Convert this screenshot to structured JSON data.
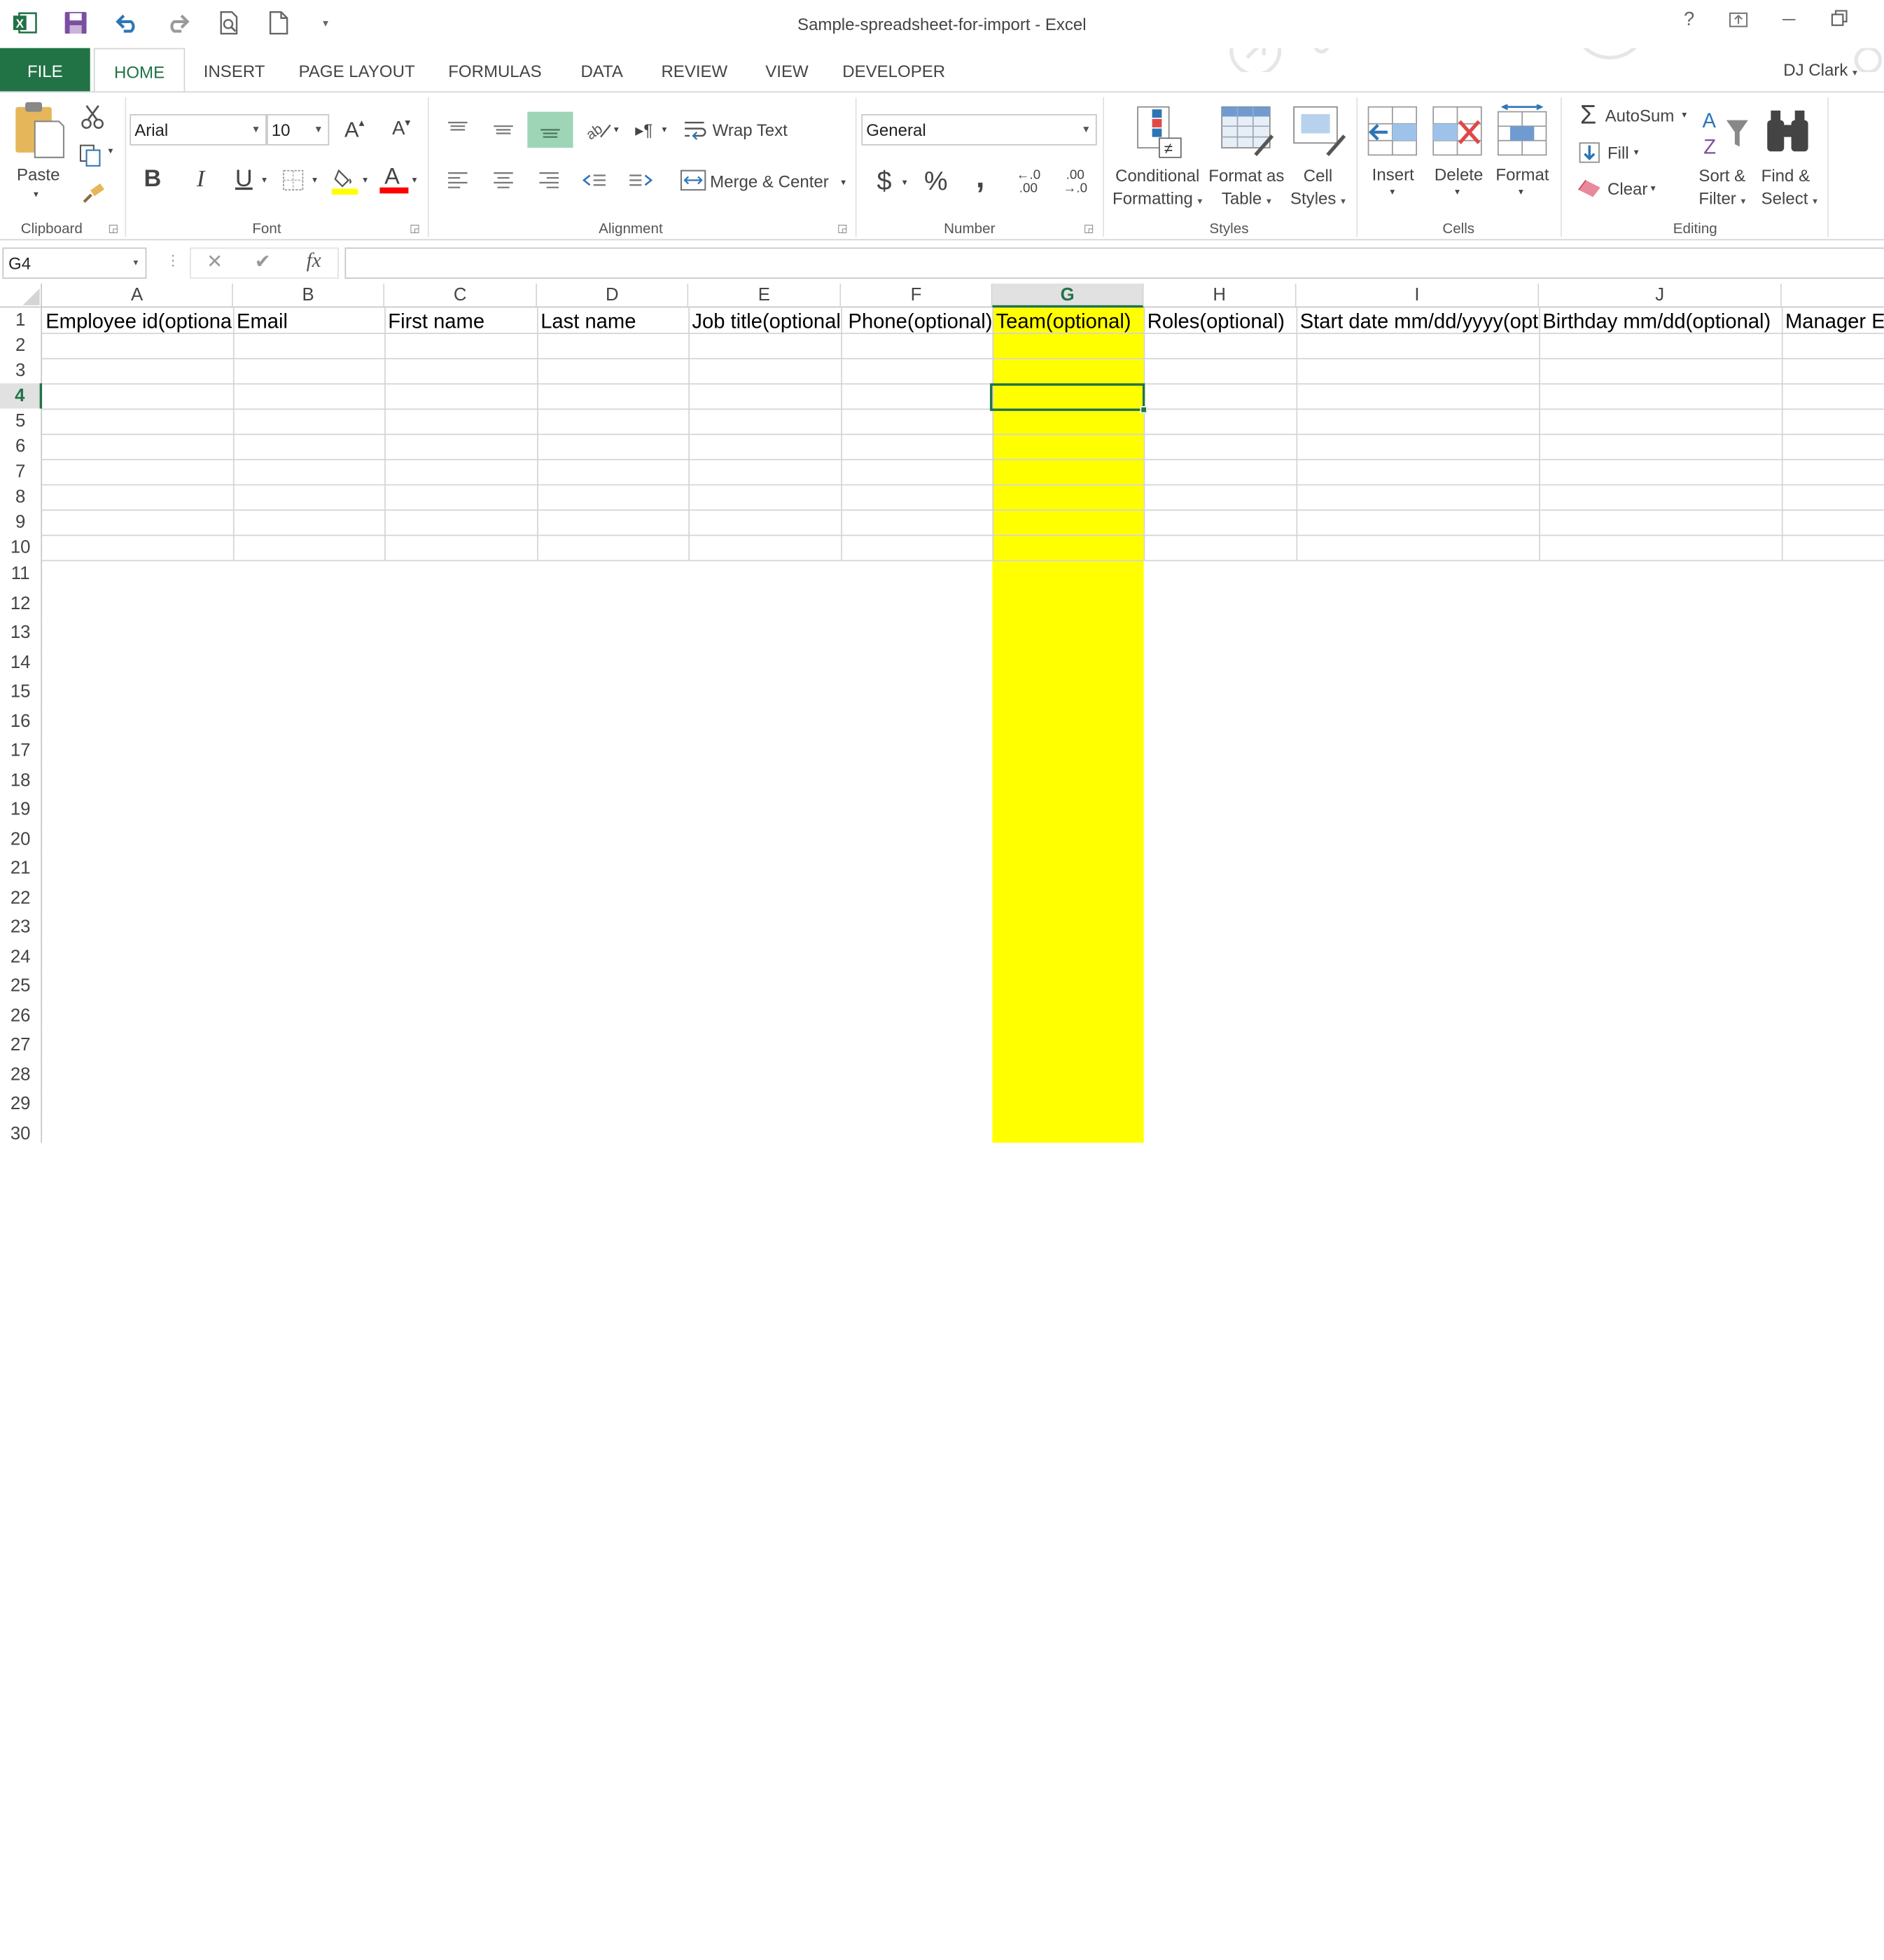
{
  "window": {
    "title": "Sample-spreadsheet-for-import - Excel",
    "user": "DJ Clark",
    "help": "?"
  },
  "tabs": [
    "FILE",
    "HOME",
    "INSERT",
    "PAGE LAYOUT",
    "FORMULAS",
    "DATA",
    "REVIEW",
    "VIEW",
    "DEVELOPER"
  ],
  "ribbon": {
    "clipboard": {
      "label": "Clipboard",
      "paste": "Paste"
    },
    "font": {
      "label": "Font",
      "name": "Arial",
      "size": "10",
      "bold": "B",
      "italic": "I",
      "underline": "U"
    },
    "alignment": {
      "label": "Alignment",
      "wrap": "Wrap Text",
      "merge": "Merge & Center"
    },
    "number": {
      "label": "Number",
      "format": "General",
      "currency": "$",
      "percent": "%",
      "comma": ",",
      "inc_decimal": "←.0\n.00",
      "dec_decimal": ".00\n→.0"
    },
    "styles": {
      "label": "Styles",
      "conditional": "Conditional\nFormatting",
      "format_table": "Format as\nTable",
      "cell_styles": "Cell\nStyles"
    },
    "cells": {
      "label": "Cells",
      "insert": "Insert",
      "delete": "Delete",
      "format": "Format"
    },
    "editing": {
      "label": "Editing",
      "autosum": "AutoSum",
      "fill": "Fill",
      "clear": "Clear",
      "sort": "Sort &\nFilter",
      "find": "Find &\nSelect"
    }
  },
  "formula_bar": {
    "name_box": "G4",
    "fx": "fx",
    "value": ""
  },
  "sheet": {
    "columns": [
      "A",
      "B",
      "C",
      "D",
      "E",
      "F",
      "G",
      "H",
      "I",
      "J"
    ],
    "rows": [
      "1",
      "2",
      "3",
      "4",
      "5",
      "6",
      "7",
      "8",
      "9",
      "10",
      "11",
      "12",
      "13",
      "14",
      "15",
      "16",
      "17",
      "18",
      "19",
      "20",
      "21",
      "22",
      "23",
      "24",
      "25",
      "26",
      "27",
      "28",
      "29",
      "30"
    ],
    "headers": [
      "Employee id(optiona",
      "Email",
      "First name",
      "Last name",
      "Job title(optional",
      "Phone(optional)",
      "Team(optional)",
      "Roles(optional)",
      "Start date mm/dd/yyyy(opti",
      "Birthday mm/dd(optional)",
      "Manager E"
    ],
    "active_cell": "G4",
    "highlight_color": "#ffff00",
    "accent_color": "#217346"
  }
}
